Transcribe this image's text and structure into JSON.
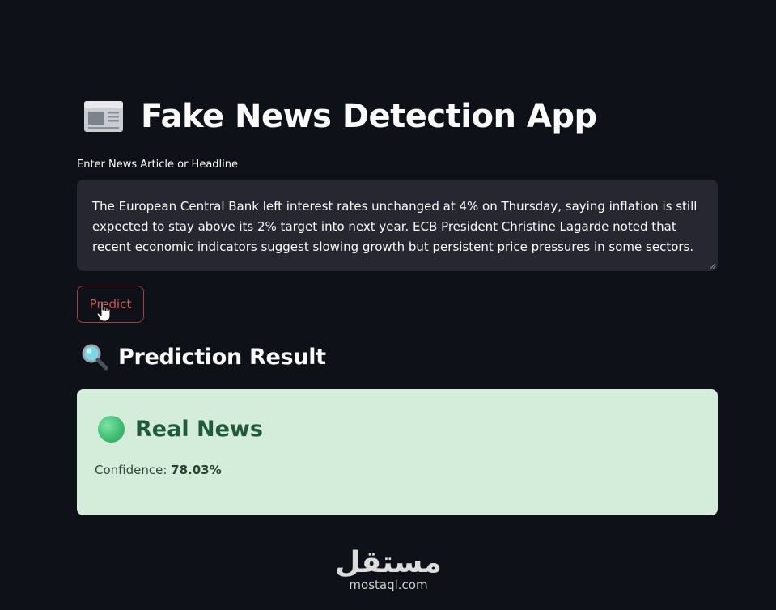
{
  "app": {
    "title": "Fake News Detection App",
    "title_icon": "newspaper-icon"
  },
  "input": {
    "label": "Enter News Article or Headline",
    "value": "The European Central Bank left interest rates unchanged at 4% on Thursday, saying inflation is still expected to stay above its 2% target into next year. ECB President Christine Lagarde noted that recent economic indicators suggest slowing growth but persistent price pressures in some sectors."
  },
  "predict_button": {
    "label": "Predict"
  },
  "result": {
    "heading": "Prediction Result",
    "heading_icon": "magnifying-glass-icon",
    "verdict": "Real News",
    "verdict_icon": "green-circle-icon",
    "confidence_label": "Confidence: ",
    "confidence_value": "78.03%"
  },
  "watermark": {
    "arabic": "مستقل",
    "latin": "mostaql.com"
  },
  "colors": {
    "background": "#0e1117",
    "input_bg": "#262730",
    "button_border": "#a8413a",
    "success_bg": "#d4ecda",
    "success_text": "#1f5a3a"
  }
}
